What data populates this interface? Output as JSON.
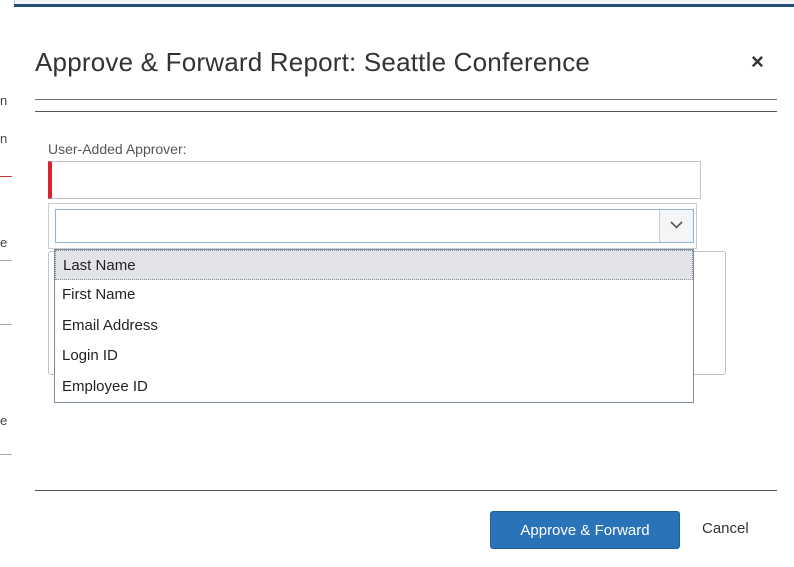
{
  "background": {
    "fragments": [
      "n",
      "n",
      "e",
      "e"
    ]
  },
  "dialog": {
    "title": "Approve & Forward Report: Seattle Conference",
    "close_glyph": "×",
    "field_label": "User-Added Approver:",
    "approver_input": {
      "value": "",
      "placeholder": ""
    },
    "search_by": {
      "selected": "",
      "options": [
        "Last Name",
        "First Name",
        "Email Address",
        "Login ID",
        "Employee ID"
      ],
      "highlighted": "Last Name"
    },
    "buttons": {
      "approve_forward": "Approve & Forward",
      "cancel": "Cancel"
    },
    "colors": {
      "primary": "#2a73b9",
      "required": "#d9232f",
      "header_bar": "#1f4e79"
    }
  }
}
